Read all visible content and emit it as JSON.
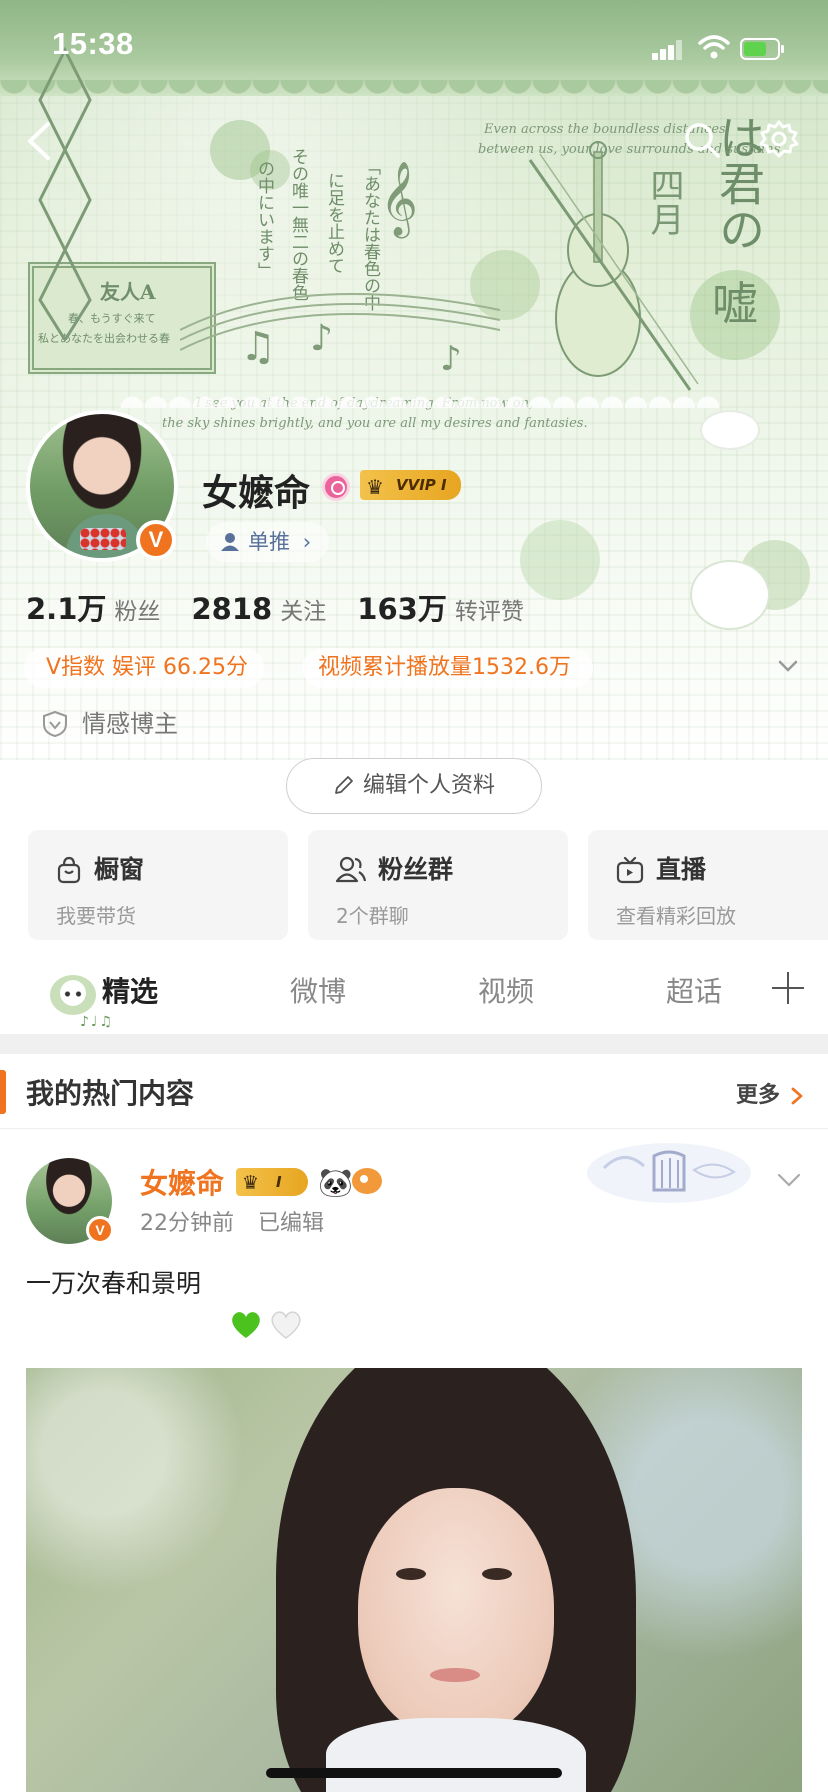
{
  "status_bar": {
    "time": "15:38"
  },
  "banner_art": {
    "stamp_title": "友人A",
    "stamp_line1": "春、もうすぐ来て",
    "stamp_line2": "私とあなたを出会わせる春",
    "vertical_1": "その唯一無二の春色",
    "vertical_2": "の中にいます」",
    "vertical_3": "に足を止めて",
    "vertical_4": "「あなたは春色の中",
    "big_title_1": "は君の",
    "big_title_2": "四月",
    "big_title_3": "嘘",
    "cursive_top_1": "Even across the boundless distances",
    "cursive_top_2": "between us, your love surrounds and sustains",
    "cursive_bottom_1": "I see you at the end of daydreaming. From now on,",
    "cursive_bottom_2": "the sky shines brightly, and you are all my desires and fantasies."
  },
  "profile": {
    "name": "女嬷命",
    "vip_label": "VVIP I",
    "tag_pill": "单推",
    "verified_mark": "V",
    "stats": [
      {
        "value": "2.1万",
        "label": "粉丝"
      },
      {
        "value": "2818",
        "label": "关注"
      },
      {
        "value": "163万",
        "label": "转评赞"
      }
    ],
    "v_index": "V指数 娱评 66.25分",
    "video_plays": "视频累计播放量1532.6万",
    "category": "情感博主",
    "edit_button": "编辑个人资料"
  },
  "cards": [
    {
      "title": "橱窗",
      "subtitle": "我要带货",
      "icon": "bag-icon"
    },
    {
      "title": "粉丝群",
      "subtitle": "2个群聊",
      "icon": "group-icon"
    },
    {
      "title": "直播",
      "subtitle": "查看精彩回放",
      "icon": "tv-icon"
    }
  ],
  "tabs": [
    {
      "label": "精选",
      "active": true
    },
    {
      "label": "微博",
      "active": false
    },
    {
      "label": "视频",
      "active": false
    },
    {
      "label": "超话",
      "active": false
    }
  ],
  "section": {
    "title": "我的热门内容",
    "more": "更多"
  },
  "post": {
    "author": "女嬷命",
    "badge": "I",
    "time": "22分钟前",
    "edited": "已编辑",
    "text": "一万次春和景明"
  },
  "colors": {
    "accent": "#f0741f",
    "vip_gold": "#e7a521",
    "banner_green": "#a9c99e"
  }
}
